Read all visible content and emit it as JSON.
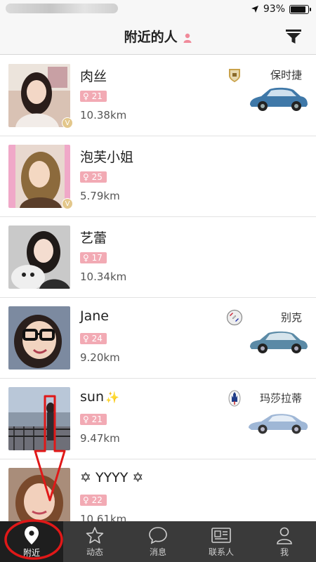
{
  "status_bar": {
    "battery_text": "93%",
    "battery_level": 0.93
  },
  "header": {
    "title": "附近的人"
  },
  "people": [
    {
      "name": "肉丝",
      "age": "21",
      "distance": "10.38km",
      "vip": true,
      "brand": "保时捷",
      "brand_logo": "porsche-logo",
      "car_color": "#3f78a8"
    },
    {
      "name": "泡芙小姐",
      "age": "25",
      "distance": "5.79km",
      "vip": true,
      "brand": "",
      "brand_logo": "",
      "car_color": ""
    },
    {
      "name": "艺蕾",
      "age": "17",
      "distance": "10.34km",
      "vip": false,
      "brand": "",
      "brand_logo": "",
      "car_color": ""
    },
    {
      "name": "Jane",
      "age": "24",
      "distance": "9.20km",
      "vip": false,
      "brand": "别克",
      "brand_logo": "buick-logo",
      "car_color": "#5b8aa6"
    },
    {
      "name": "sun",
      "name_suffix": "✨",
      "age": "21",
      "distance": "9.47km",
      "vip": false,
      "brand": "玛莎拉蒂",
      "brand_logo": "maserati-logo",
      "car_color": "#9fb7d6"
    },
    {
      "name": "✡ YYYY ✡",
      "age": "22",
      "distance": "10.61km",
      "vip": false,
      "brand": "",
      "brand_logo": "",
      "car_color": ""
    }
  ],
  "tabs": [
    {
      "label": "附近",
      "icon": "location-pin-icon",
      "active": true
    },
    {
      "label": "动态",
      "icon": "star-icon",
      "active": false
    },
    {
      "label": "消息",
      "icon": "chat-bubble-icon",
      "active": false
    },
    {
      "label": "联系人",
      "icon": "contact-card-icon",
      "active": false
    },
    {
      "label": "我",
      "icon": "person-icon",
      "active": false
    }
  ],
  "colors": {
    "age_badge": "#f2aab4",
    "tab_bar": "#3a3a3a",
    "tab_active": "#1e1e1e",
    "annotation": "#e01818"
  }
}
